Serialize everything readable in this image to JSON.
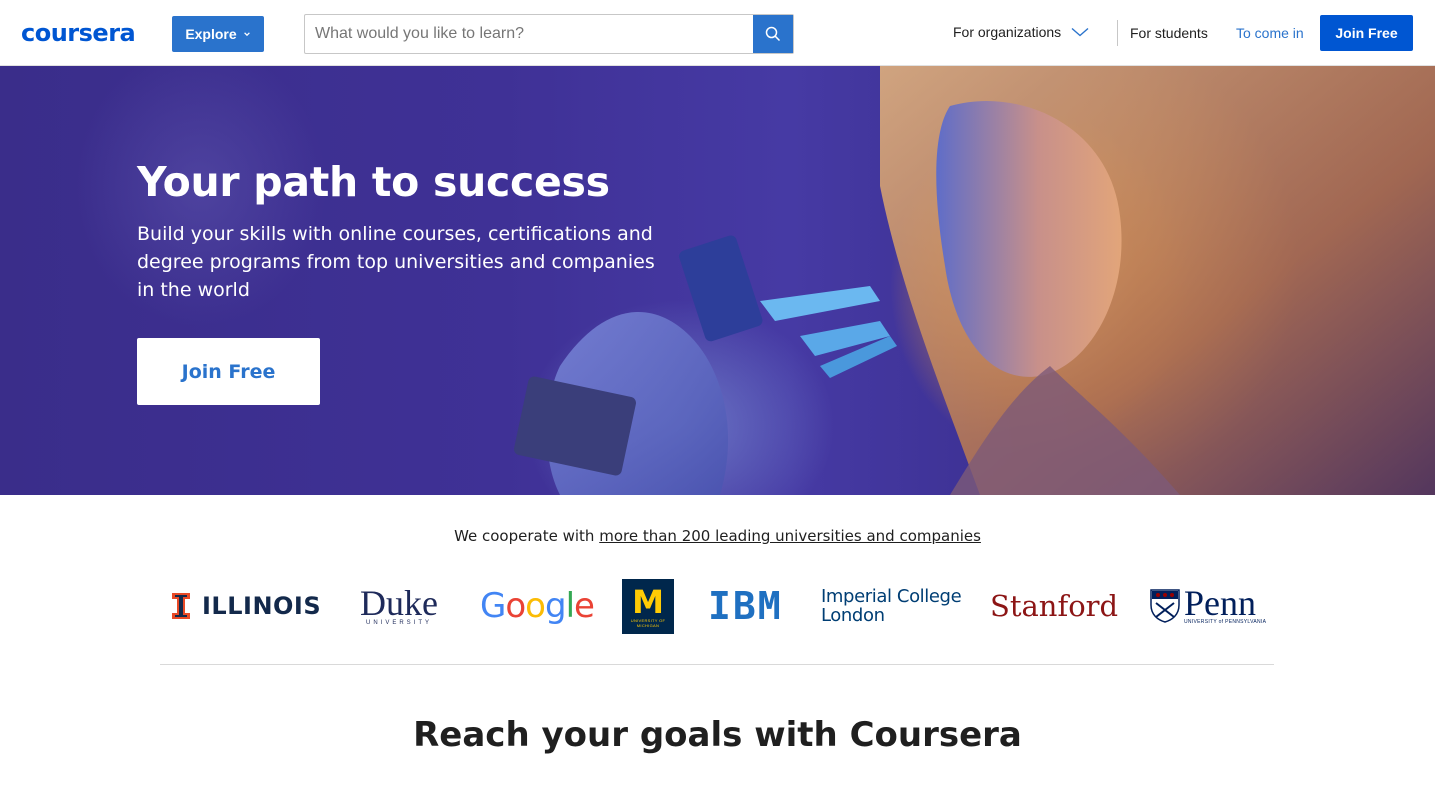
{
  "header": {
    "logo_text": "coursera",
    "explore_label": "Explore",
    "search": {
      "placeholder": "What would you like to learn?",
      "value": ""
    },
    "nav": {
      "organizations": "For organizations",
      "students": "For students",
      "login": "To come in",
      "join": "Join Free"
    }
  },
  "hero": {
    "title": "Your path to success",
    "subtitle": "Build your skills with online courses, certifications and degree programs from top universities and companies in the world",
    "cta": "Join Free"
  },
  "partners": {
    "intro": "We cooperate with",
    "link": "more than 200 leading universities and companies",
    "logos": {
      "illinois": "ILLINOIS",
      "duke": "Duke",
      "duke_sub": "UNIVERSITY",
      "google": "Google",
      "michigan": "M",
      "michigan_sub": "UNIVERSITY OF MICHIGAN",
      "ibm": "IBM",
      "imperial_line1": "Imperial College",
      "imperial_line2": "London",
      "stanford": "Stanford",
      "penn": "Penn",
      "penn_sub": "UNIVERSITY of PENNSYLVANIA"
    }
  },
  "goals": {
    "title": "Reach your goals with Coursera"
  },
  "colors": {
    "brand_blue": "#0056d2",
    "button_blue": "#2a73cc",
    "hero_purple": "#3f3196",
    "illinois_orange": "#e84a27",
    "michigan_maize": "#ffcb05",
    "stanford_red": "#8c1515"
  },
  "icons": [
    "search-icon",
    "chevron-down-icon"
  ]
}
